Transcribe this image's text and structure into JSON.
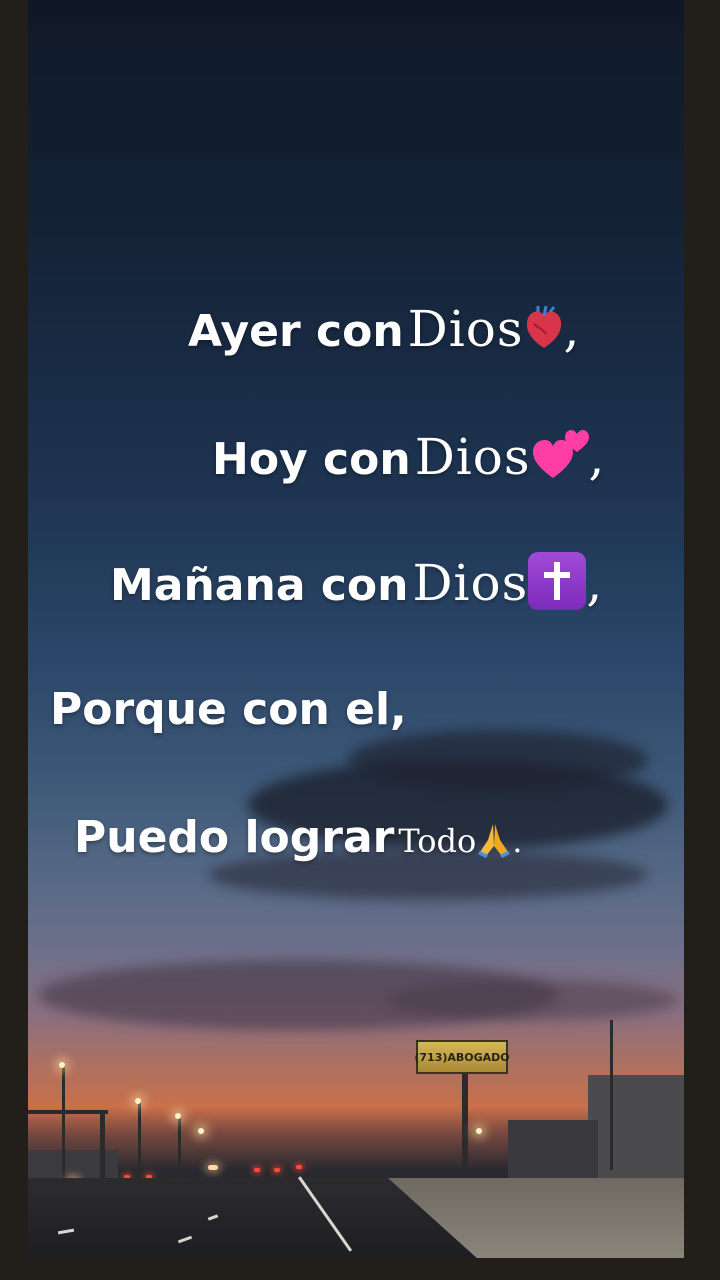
{
  "lines": {
    "line1": {
      "lead": "Ayer con",
      "word": "Dios",
      "icon": "anatomical-heart-icon",
      "punct": ","
    },
    "line2": {
      "lead": "Hoy con",
      "word": "Dios",
      "icon": "two-hearts-icon",
      "punct": ","
    },
    "line3": {
      "lead": "Mañana con",
      "word": "Dios",
      "icon": "latin-cross-icon",
      "punct": ","
    },
    "line4": {
      "lead": "Porque con el,"
    },
    "line5": {
      "lead": "Puedo lograr",
      "word": "Todo",
      "icon": "folded-hands-icon",
      "punct": "."
    }
  },
  "scene": {
    "billboard_text": "(713)ABOGADO"
  },
  "colors": {
    "text": "#ffffff",
    "sky_top": "#0f1826",
    "sunset": "#c9704a",
    "cross_badge": "#8e38c9",
    "hearts": "#ff3ea5"
  }
}
